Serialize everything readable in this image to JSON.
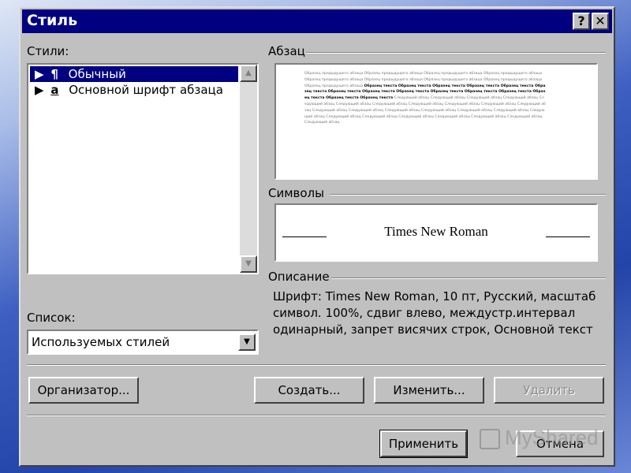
{
  "dialog": {
    "title": "Стиль",
    "help_label": "?",
    "close_label": "✕"
  },
  "styles": {
    "label": "Стили:",
    "items": [
      {
        "marker": "¶",
        "label": "Обычный",
        "selected": true
      },
      {
        "marker": "a",
        "label": "Основной шрифт абзаца",
        "selected": false
      }
    ]
  },
  "list": {
    "label": "Список:",
    "value": "Используемых стилей"
  },
  "paragraph": {
    "label": "Абзац",
    "prev_sample": "Образец предыдущего абзаца Образец предыдущего абзаца Образец предыдущего абзаца Образец предыдущего абзаца Образец предыдущего абзаца Образец предыдущего абзаца Образец предыдущего абзаца Образец предыдущего абзаца Образец предыдущего абзаца ",
    "cur_sample": "Образец текста Образец текста Образец текста Образец текста Образец текста Образец текста Образец текста Образец текста Образец текста Образец текста Образец текста Образец текста Образец текста Образец текста Образец текста ",
    "next_sample": "Следующий абзац Следующий абзац Следующий абзац Следующий абзац Следующий абзац Следующий абзац Следующий абзац Следующий абзац Следующий абзац Следующий абзац Следующий абзац Следующий абзац Следующий абзац Следующий абзац Следующий абзац Следующий абзац Следующий абзац Следующий абзац Следующий абзац Следующий абзац Следующий абзац Следующий абзац Следующий абзац Следующий абзац Следующий абзац"
  },
  "symbols": {
    "label": "Символы",
    "sample": "Times New Roman"
  },
  "description": {
    "label": "Описание",
    "text": "Шрифт: Times New Roman, 10 пт, Русский, масштаб символ. 100%, сдвиг влево, междустр.интервал одинарный, запрет висячих строк, Основной текст"
  },
  "buttons": {
    "organizer": "Организатор...",
    "create": "Создать...",
    "modify": "Изменить...",
    "delete": "Удалить",
    "apply": "Применить",
    "cancel": "Отмена"
  },
  "watermark": {
    "text": "MyShared"
  }
}
